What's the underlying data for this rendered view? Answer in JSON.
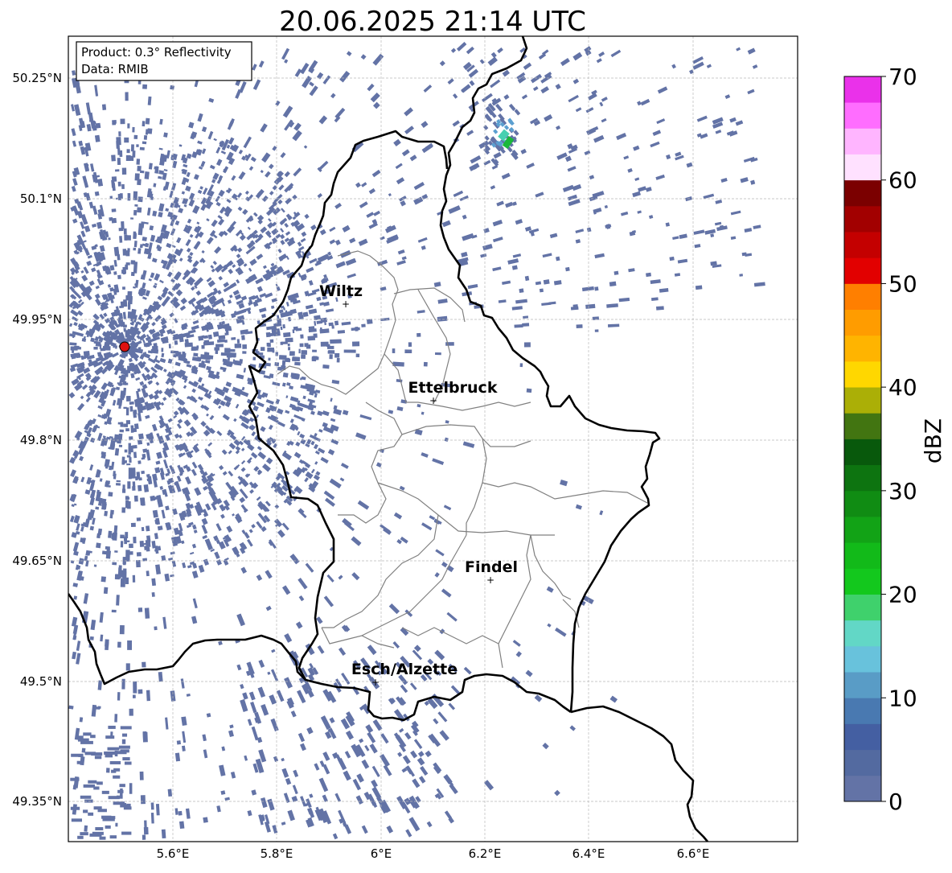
{
  "title": "20.06.2025 21:14 UTC",
  "info_box": {
    "product": "Product: 0.3° Reflectivity",
    "data": "Data: RMIB"
  },
  "lat_ticks": [
    "50.25°N",
    "50.1°N",
    "49.95°N",
    "49.8°N",
    "49.65°N",
    "49.5°N",
    "49.35°N"
  ],
  "lon_ticks": [
    "5.6°E",
    "5.8°E",
    "6°E",
    "6.2°E",
    "6.4°E",
    "6.6°E"
  ],
  "cities": [
    {
      "name": "Wiltz"
    },
    {
      "name": "Ettelbruck"
    },
    {
      "name": "Findel"
    },
    {
      "name": "Esch/Alzette"
    }
  ],
  "colorbar": {
    "label": "dBZ",
    "tick_labels": [
      "0",
      "10",
      "20",
      "30",
      "40",
      "50",
      "60",
      "70"
    ],
    "min": 0,
    "max": 70,
    "step": 2.5,
    "colors": [
      "#6373a6",
      "#536aa0",
      "#445fa2",
      "#4979b1",
      "#599cc6",
      "#68c2dc",
      "#62d7c6",
      "#3fd16c",
      "#13c81d",
      "#12ba19",
      "#12a316",
      "#108c13",
      "#0d7410",
      "#08590c",
      "#427511",
      "#abaf06",
      "#ffd700",
      "#ffb400",
      "#ff9c00",
      "#ff7f00",
      "#e20000",
      "#c40000",
      "#a20000",
      "#7b0000",
      "#ffe1ff",
      "#ffb5ff",
      "#ff6dff",
      "#ea31ea"
    ]
  },
  "colors": {
    "echo_light": "#6373a6",
    "echo_mid": "#5b9fd0",
    "echo_cyan": "#48d0b0",
    "echo_green": "#1ab83a",
    "radar_site": "#dd1111",
    "border": "#000000",
    "canton_border": "#808080",
    "grid": "#b9b9b9"
  }
}
